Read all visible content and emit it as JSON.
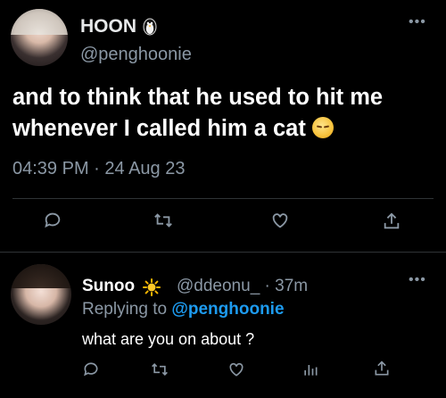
{
  "tweet": {
    "display_name": "HOON",
    "name_badge_icon": "penguin-emoji",
    "handle": "@penghoonie",
    "text": "and to think that he used to hit me whenever I called him a cat",
    "text_emoji": "pensive-face-emoji",
    "timestamp": "04:39 PM · 24 Aug 23",
    "more_icon": "more-dots-icon",
    "actions": [
      "reply-icon",
      "retweet-icon",
      "like-icon",
      "share-icon"
    ]
  },
  "reply": {
    "display_name": "Sunoo",
    "name_badge_icon": "sun-emoji",
    "handle_time": "@ddeonu_ · 37m",
    "replying_prefix": "Replying to",
    "replying_handle": "@penghoonie",
    "text": "what are you on about ?",
    "more_icon": "more-dots-icon",
    "actions": [
      "reply-icon",
      "retweet-icon",
      "like-icon",
      "analytics-icon",
      "share-icon"
    ]
  },
  "colors": {
    "background": "#000000",
    "text": "#e7e9ea",
    "muted": "#8b98a5",
    "accent": "#1d9bf0",
    "divider": "#2f3336"
  }
}
